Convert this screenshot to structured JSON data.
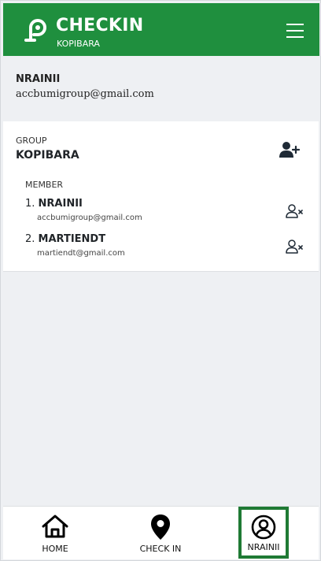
{
  "header": {
    "app_title": "CHECKIN",
    "app_subtitle": "KOPIBARA",
    "brand_color": "#1f8f3e"
  },
  "user": {
    "name": "NRAINII",
    "email": "accbumigroup@gmail.com"
  },
  "group": {
    "label": "GROUP",
    "name": "KOPIBARA",
    "member_label": "MEMBER",
    "members": [
      {
        "number": "1.",
        "name": "NRAINII",
        "email": "accbumigroup@gmail.com"
      },
      {
        "number": "2.",
        "name": "MARTIENDT",
        "email": "martiendt@gmail.com"
      }
    ]
  },
  "bottom_nav": {
    "items": [
      {
        "label": "HOME",
        "icon": "home-icon"
      },
      {
        "label": "CHECK IN",
        "icon": "map-pin-icon"
      },
      {
        "label": "NRAINII",
        "icon": "user-circle-icon",
        "active": true
      }
    ],
    "active_border_color": "#1f7a34"
  }
}
